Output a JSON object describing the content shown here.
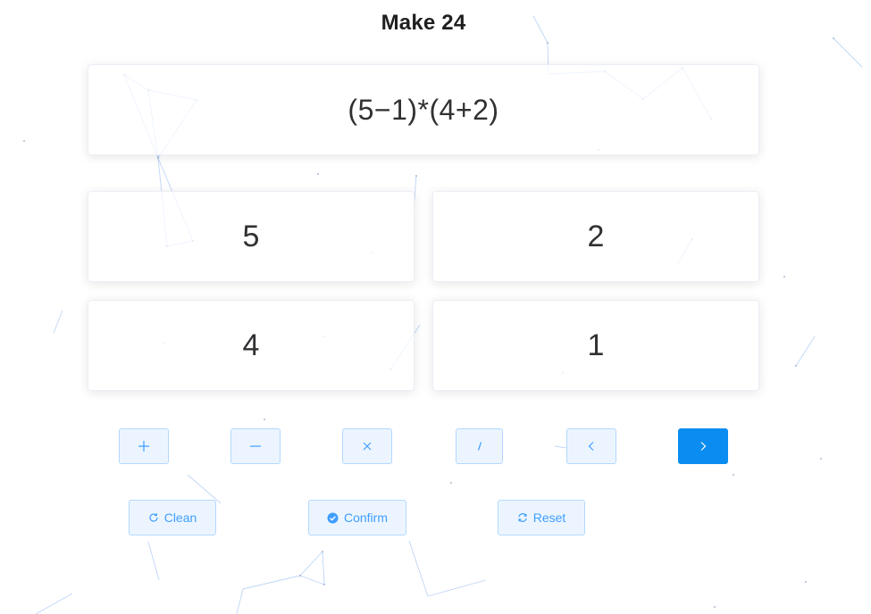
{
  "title": "Make 24",
  "expression": "(5−1)*(4+2)",
  "numbers": [
    "5",
    "2",
    "4",
    "1"
  ],
  "operators": [
    {
      "label": "+",
      "icon": "plus-icon"
    },
    {
      "label": "−",
      "icon": "minus-icon"
    },
    {
      "label": "×",
      "icon": "multiply-icon"
    },
    {
      "label": "/",
      "icon": "divide-icon"
    },
    {
      "label": "",
      "icon": "chevron-left-icon"
    },
    {
      "label": "",
      "icon": "chevron-right-icon"
    }
  ],
  "actions": {
    "clean_label": "Clean",
    "confirm_label": "Confirm",
    "reset_label": "Reset"
  },
  "colors": {
    "accent": "#409eff",
    "primary_button": "#0a8cf0",
    "light_button_bg": "#ecf5ff",
    "light_button_border": "#b3d8ff",
    "particle_line": "#a9c7f5"
  }
}
